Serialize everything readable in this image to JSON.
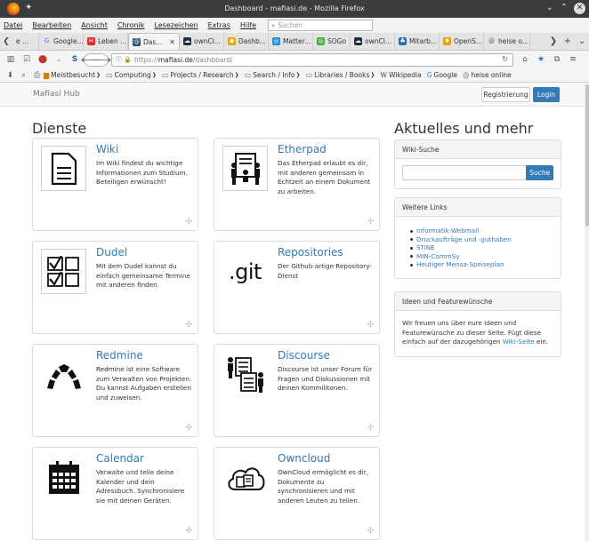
{
  "window": {
    "title": "Dashboard - mafiasi.de - Mozilla Firefox"
  },
  "menu": {
    "items": [
      "Datei",
      "Bearbeiten",
      "Ansicht",
      "Chronik",
      "Lesezeichen",
      "Extras",
      "Hilfe"
    ],
    "search_placeholder": "Suchen"
  },
  "tabs": [
    {
      "label": "Google...",
      "color": "#ffffff",
      "glyph": "G"
    },
    {
      "label": "Leben ...",
      "color": "#e3242b",
      "glyph": "H"
    },
    {
      "label": "Das...",
      "color": "#1c4f80",
      "glyph": "@"
    },
    {
      "label": "ownCl...",
      "color": "#1d2d44",
      "glyph": "☁"
    },
    {
      "label": "Dashb...",
      "color": "#e8a200",
      "glyph": "◉"
    },
    {
      "label": "Matter...",
      "color": "#2389d7",
      "glyph": "◎"
    },
    {
      "label": "SOGo",
      "color": "#49a942",
      "glyph": "◎"
    },
    {
      "label": "ownCl...",
      "color": "#1d2d44",
      "glyph": "☁"
    },
    {
      "label": "Mitarb...",
      "color": "#2d6db5",
      "glyph": "♣"
    },
    {
      "label": "OpenS...",
      "color": "#e8a200",
      "glyph": "❖"
    },
    {
      "label": "heise o...",
      "color": "#ffffff",
      "glyph": "@"
    }
  ],
  "tab_first_label": "e ...",
  "url": {
    "pre": "https://",
    "host": "mafiasi.de",
    "path": "/dashboard/"
  },
  "bookmarks": [
    {
      "label": "Meistbesucht",
      "dropdown": true
    },
    {
      "label": "Computing",
      "dropdown": true
    },
    {
      "label": "Projects / Research",
      "dropdown": true
    },
    {
      "label": "Search / Info",
      "dropdown": true
    },
    {
      "label": "Libraries / Books",
      "dropdown": true
    },
    {
      "label": "Wikipedia",
      "dropdown": false,
      "glyph": "W"
    },
    {
      "label": "Google",
      "dropdown": false,
      "glyph": "G"
    },
    {
      "label": "heise online",
      "dropdown": false,
      "glyph": "@"
    }
  ],
  "site": {
    "brand": "Mafiasi Hub",
    "register": "Registrierung",
    "login": "Login"
  },
  "dienste": {
    "heading": "Dienste",
    "cards": [
      {
        "key": "wiki",
        "title": "Wiki",
        "desc": "Im Wiki findest du wichtige Informationen zum Studium. Beteiligen erwünscht!"
      },
      {
        "key": "etherpad",
        "title": "Etherpad",
        "desc": "Das Etherpad erlaubt es dir, mit anderen gemeinsam in Echtzeit an einem Dokument zu arbeiten."
      },
      {
        "key": "dudel",
        "title": "Dudel",
        "desc": "Mit dem Dudel kannst du einfach gemeinsame Termine mit anderen finden."
      },
      {
        "key": "repositories",
        "title": "Repositories",
        "desc": "Der Github-artige Repository-Dienst",
        "icon_text": ".git"
      },
      {
        "key": "redmine",
        "title": "Redmine",
        "desc": "Redmine ist eine Software zum Verwalten von Projekten. Du kannst Aufgaben erstellen und zuweisen."
      },
      {
        "key": "discourse",
        "title": "Discourse",
        "desc": "Discourse ist unser Forum für Fragen und Diskussionen mit deinen Kommilitonen."
      },
      {
        "key": "calendar",
        "title": "Calendar",
        "desc": "Verwalte und teile deine Kalender und dein Adressbuch. Synchronisiere sie mit deinen Geräten."
      },
      {
        "key": "owncloud",
        "title": "Owncloud",
        "desc": "OwnCloud ermöglicht es dir, Dokumente zu synchronisieren und mit anderen Leuten zu teilen."
      }
    ]
  },
  "sidebar": {
    "heading": "Aktuelles und mehr",
    "wiki_search": {
      "title": "Wiki-Suche",
      "button": "Suche"
    },
    "links": {
      "title": "Weitere Links",
      "items": [
        "Informatik-Webmail",
        "Druckaufträge und -guthaben",
        "STiNE",
        "MIN-CommSy",
        "Heutiger Mensa-Speiseplan"
      ]
    },
    "ideas": {
      "title": "Ideen und Featurewünsche",
      "text_before": "Wir freuen uns über eure Ideen und Featurewünsche zu dieser Seite. Fügt diese einfach auf der dazugehörigen",
      "link": "Wiki-Seite",
      "text_after": "ein."
    }
  },
  "colors": {
    "accent": "#337ab7",
    "titlebar": "#3b3c3e"
  }
}
